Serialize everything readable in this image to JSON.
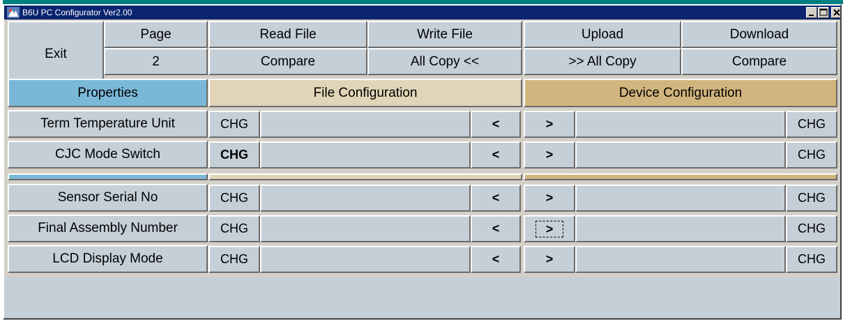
{
  "window": {
    "title": "B6U PC Configurator Ver2.00"
  },
  "toolbar": {
    "exit_label": "Exit",
    "page_label": "Page",
    "page_number": "2",
    "read_file_label": "Read File",
    "write_file_label": "Write File",
    "upload_label": "Upload",
    "download_label": "Download",
    "compare_left_label": "Compare",
    "all_copy_left_label": "All Copy  <<",
    "all_copy_right_label": ">>  All Copy",
    "compare_right_label": "Compare"
  },
  "headers": {
    "properties": "Properties",
    "file_configuration": "File Configuration",
    "device_configuration": "Device Configuration"
  },
  "rows_group1": [
    {
      "property": "Term Temperature Unit",
      "chg_left": "CHG",
      "left_arrow": "<",
      "right_arrow": ">",
      "chg_right": "CHG",
      "file_value": "",
      "device_value": ""
    },
    {
      "property": "CJC Mode Switch",
      "chg_left": "CHG",
      "left_arrow": "<",
      "right_arrow": ">",
      "chg_right": "CHG",
      "file_value": "",
      "device_value": ""
    }
  ],
  "rows_group2": [
    {
      "property": "Sensor Serial No",
      "chg_left": "CHG",
      "left_arrow": "<",
      "right_arrow": ">",
      "chg_right": "CHG",
      "file_value": "",
      "device_value": ""
    },
    {
      "property": "Final Assembly Number",
      "chg_left": "CHG",
      "left_arrow": "<",
      "right_arrow": ">",
      "chg_right": "CHG",
      "file_value": "",
      "device_value": ""
    },
    {
      "property": "LCD Display Mode",
      "chg_left": "CHG",
      "left_arrow": "<",
      "right_arrow": ">",
      "chg_right": "CHG",
      "file_value": "",
      "device_value": ""
    }
  ],
  "colors": {
    "titlebar": "#0a2470",
    "properties_header": "#7ab8d8",
    "file_header": "#e2d5b7",
    "device_header": "#d2b57e",
    "button_face": "#c5cfd8"
  },
  "icons": {
    "app": "app-logo-icon",
    "minimize": "minimize-icon",
    "maximize": "maximize-icon",
    "close": "close-icon"
  }
}
